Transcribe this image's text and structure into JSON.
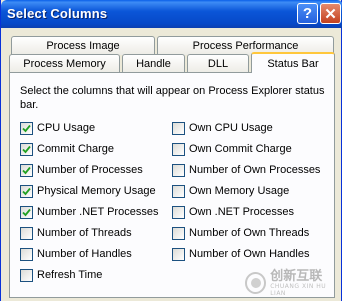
{
  "window": {
    "title": "Select Columns",
    "help_glyph": "?",
    "close_glyph": "✕"
  },
  "tabs": {
    "row1": [
      "Process Image",
      "Process Performance"
    ],
    "row2": [
      "Process Memory",
      "Handle",
      "DLL",
      "Status Bar"
    ],
    "active": "Status Bar"
  },
  "panel": {
    "description": "Select the columns that will appear on Process Explorer status bar.",
    "options_left": [
      {
        "label": "CPU Usage",
        "checked": true
      },
      {
        "label": "Commit Charge",
        "checked": true
      },
      {
        "label": "Number of Processes",
        "checked": true
      },
      {
        "label": "Physical Memory Usage",
        "checked": true
      },
      {
        "label": "Number .NET Processes",
        "checked": true
      },
      {
        "label": "Number of Threads",
        "checked": false
      },
      {
        "label": "Number of Handles",
        "checked": false
      },
      {
        "label": "Refresh Time",
        "checked": false
      }
    ],
    "options_right": [
      {
        "label": "Own CPU Usage",
        "checked": false
      },
      {
        "label": "Own Commit Charge",
        "checked": false
      },
      {
        "label": "Number of Own Processes",
        "checked": false
      },
      {
        "label": "Own Memory Usage",
        "checked": false
      },
      {
        "label": "Own .NET Processes",
        "checked": false
      },
      {
        "label": "Number of Own Threads",
        "checked": false
      },
      {
        "label": "Number of Own Handles",
        "checked": false
      }
    ]
  },
  "watermark": {
    "text": "创新互联",
    "sub": "CHUANG XIN HU LIAN"
  },
  "colors": {
    "titlebar": "#0b56d8",
    "tab_highlight": "#ffc73c",
    "checkmark": "#21a121"
  }
}
